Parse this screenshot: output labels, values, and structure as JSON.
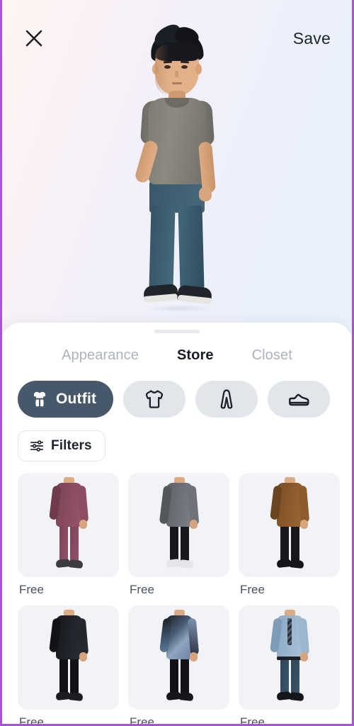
{
  "header": {
    "close_label": "Close",
    "close_icon": "close-icon",
    "save_label": "Save"
  },
  "avatar": {
    "description": "3D male avatar with black spiky hair, grey t-shirt, teal-blue jeans and dark sneakers"
  },
  "sheet": {
    "drag_handle": "drag-handle",
    "tabs": [
      {
        "label": "Appearance",
        "active": false
      },
      {
        "label": "Store",
        "active": true
      },
      {
        "label": "Closet",
        "active": false
      }
    ],
    "categories": [
      {
        "label": "Outfit",
        "icon": "outfit-icon",
        "active": true
      },
      {
        "label": "",
        "icon": "tshirt-icon",
        "active": false
      },
      {
        "label": "",
        "icon": "pants-icon",
        "active": false
      },
      {
        "label": "",
        "icon": "shoe-icon",
        "active": false
      }
    ],
    "filters": {
      "label": "Filters",
      "icon": "sliders-icon"
    },
    "products": [
      {
        "price": "Free",
        "outfit": "maroon-suit"
      },
      {
        "price": "Free",
        "outfit": "grey-cardigan"
      },
      {
        "price": "Free",
        "outfit": "brown-jacket"
      },
      {
        "price": "Free",
        "outfit": "black-jacket"
      },
      {
        "price": "Free",
        "outfit": "graphic-hoodie"
      },
      {
        "price": "Free",
        "outfit": "blue-shirt-tie"
      }
    ]
  },
  "colors": {
    "accent_dark": "#46586a",
    "pill_bg": "#e2e5ea",
    "card_bg": "#f1f3f7",
    "text_primary": "#171c26",
    "text_muted": "#adb2bd",
    "page_border": "#a855d6"
  }
}
